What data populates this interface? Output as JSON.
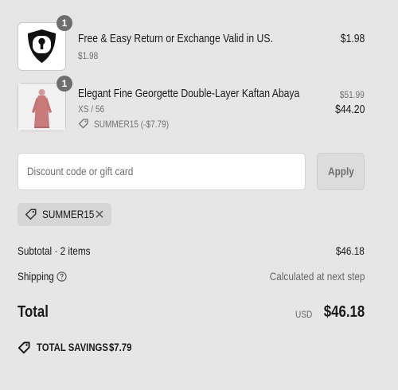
{
  "items": [
    {
      "title": "Free & Easy Return or Exchange Valid in US.",
      "subtitle": "$1.98",
      "price": "$1.98",
      "quantity": "1",
      "thumbnail_icon": "shield-keyhole-icon"
    },
    {
      "title": "Elegant Fine Georgette Double-Layer Kaftan Abaya",
      "variant": "XS / 56",
      "discount_note": "SUMMER15 (-$7.79)",
      "original_price": "$51.99",
      "price": "$44.20",
      "quantity": "1",
      "thumbnail_icon": "abaya-product-image"
    }
  ],
  "discount": {
    "placeholder": "Discount code or gift card",
    "apply_label": "Apply",
    "applied_code": "SUMMER15"
  },
  "summary": {
    "subtotal_label": "Subtotal · 2 items",
    "subtotal_value": "$46.18",
    "shipping_label": "Shipping",
    "shipping_value": "Calculated at next step",
    "total_label": "Total",
    "currency": "USD",
    "total_value": "$46.18",
    "savings_label": "TOTAL SAVINGS",
    "savings_value": "$7.79"
  },
  "colors": {
    "background": "#e6e6e6",
    "badge": "#6e6e6e",
    "apply_button": "#dcdcdc",
    "product_dress": "#c97a7a"
  }
}
